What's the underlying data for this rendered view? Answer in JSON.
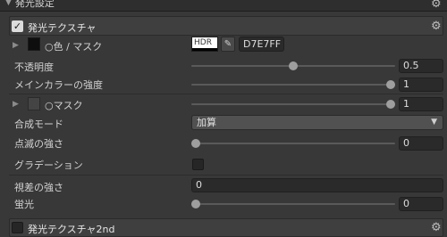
{
  "top_section": {
    "title": "発光設定"
  },
  "emission": {
    "title": "発光テクスチャ",
    "enabled": true,
    "color_mask": {
      "label": "○色 / マスク",
      "hdr_label": "HDR",
      "hex_value": "D7E7FF"
    },
    "opacity": {
      "label": "不透明度",
      "value": "0.5",
      "fraction": 0.5
    },
    "main_color_strength": {
      "label": "メインカラーの強度",
      "value": "1",
      "fraction": 1.0
    },
    "mask": {
      "label": "○マスク",
      "value": "1",
      "fraction": 1.0
    },
    "blend_mode": {
      "label": "合成モード",
      "selected": "加算"
    },
    "blink_strength": {
      "label": "点滅の強さ",
      "value": "0",
      "fraction": 0.0
    },
    "gradation": {
      "label": "グラデーション",
      "checked": false
    },
    "parallax_strength": {
      "label": "視差の強さ",
      "value": "0"
    },
    "fluorescence": {
      "label": "蛍光",
      "value": "0",
      "fraction": 0.0
    }
  },
  "emission_2nd": {
    "title": "発光テクスチャ2nd",
    "enabled": false
  },
  "icons": {
    "gear": "gear-icon",
    "foldout": "triangle-down-icon",
    "expand": "triangle-right-icon",
    "eyedropper": "eyedropper-icon",
    "check": "check-icon"
  },
  "colors": {
    "background": "#383838",
    "header": "#2e2e2e",
    "field": "#2a2a2a",
    "swatch": "#D7E7FF"
  }
}
